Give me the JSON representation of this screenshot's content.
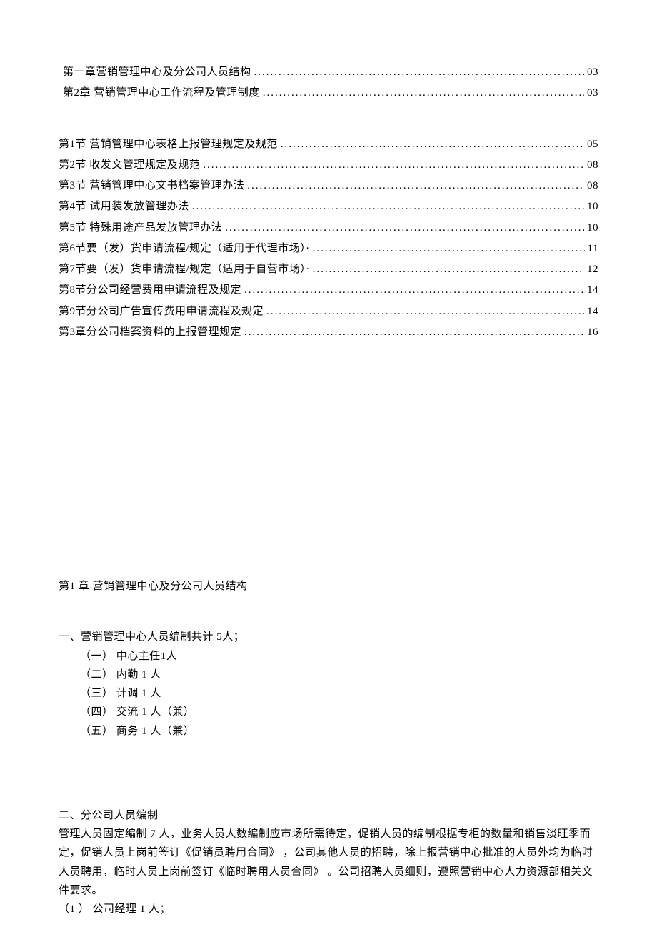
{
  "toc_top": [
    {
      "label": "第一章营销管理中心及分公司人员结构",
      "page": "03"
    },
    {
      "label": "第2章  营销管理中心工作流程及管理制度",
      "page": "03"
    }
  ],
  "toc_sections": [
    {
      "label": "第1节  营销管理中心表格上报管理规定及规范",
      "page": "05"
    },
    {
      "label": "第2节  收发文管理规定及规范",
      "page": "08"
    },
    {
      "label": "第3节  营销管理中心文书档案管理办法",
      "page": "08"
    },
    {
      "label": "第4节  试用装发放管理办法",
      "page": "10"
    },
    {
      "label": "第5节   特殊用途产品发放管理办法",
      "page": "10"
    },
    {
      "label": "第6节要（发）货申请流程/规定（适用于代理市场）·",
      "page": "11"
    },
    {
      "label": "第7节要（发）货申请流程/规定（适用于自营市场）·",
      "page": "12"
    },
    {
      "label": "第8节分公司经营费用申请流程及规定",
      "page": "14"
    },
    {
      "label": "第9节分公司广告宣传费用申请流程及规定",
      "page": "14"
    },
    {
      "label": "第3章分公司档案资料的上报管理规定",
      "page": "16"
    }
  ],
  "body": {
    "chapter_title": "第1 章  营销管理中心及分公司人员结构",
    "sec1_title": "一、营销管理中心人员编制共计  5人；",
    "sec1_items": [
      "（一）  中心主任1人",
      "（二）  内勤   1 人",
      "（三）  计调   1 人",
      "（四）  交流   1 人（兼）",
      "（五）  商务   1 人（兼）"
    ],
    "sec2_title": "二、分公司人员编制",
    "sec2_p1": "管理人员固定编制  7 人，业务人员人数编制应市场所需待定，促销人员的编制根据专柜的数量和销售淡旺季而定，促销人员上岗前签订《促销员聘用合同》   ，公司其他人员的招聘，除上报营销中心批准的人员外均为临时人员聘用，临时人员上岗前签订《临时聘用人员合同》   。公司招聘人员细则，遵照营销中心人力资源部相关文件要求。",
    "sec2_item1": "（1 ）  公司经理   1 人；"
  }
}
